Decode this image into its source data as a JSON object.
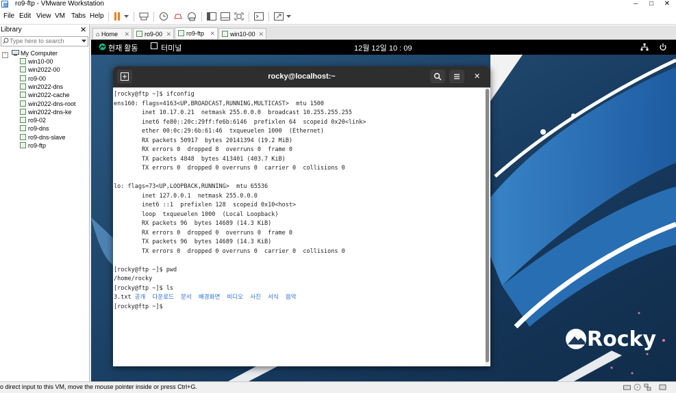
{
  "window": {
    "title": "ro9-ftp - VMware Workstation",
    "controls": [
      "–",
      "□",
      "✕"
    ]
  },
  "menu": [
    "File",
    "Edit",
    "View",
    "VM",
    "Tabs",
    "Help"
  ],
  "library": {
    "title": "Library",
    "search_placeholder": "Type here to search",
    "root": "My Computer",
    "vms": [
      "win10-00",
      "win2022-00",
      "ro9-00",
      "win2022-dns",
      "win2022-cache",
      "win2022-dns-root",
      "win2022-dns-ke",
      "ro9-02",
      "ro9-dns",
      "ro9-dns-slave",
      "ro9-ftp"
    ]
  },
  "tabs": [
    {
      "label": "Home"
    },
    {
      "label": "ro9-00"
    },
    {
      "label": "ro9-ftp"
    },
    {
      "label": "win10-00"
    }
  ],
  "gnome": {
    "activities": "현재 활동",
    "app": "터미널",
    "clock": "12월 12일  10 : 09"
  },
  "terminal": {
    "title": "rocky@localhost:~",
    "lines": [
      "[rocky@ftp ~]$ ifconfig",
      "ens160: flags=4163<UP,BROADCAST,RUNNING,MULTICAST>  mtu 1500",
      "        inet 10.17.0.21  netmask 255.0.0.0  broadcast 10.255.255.255",
      "        inet6 fe80::20c:29ff:fe6b:6146  prefixlen 64  scopeid 0x20<link>",
      "        ether 00:0c:29:6b:61:46  txqueuelen 1000  (Ethernet)",
      "        RX packets 50917  bytes 20141394 (19.2 MiB)",
      "        RX errors 0  dropped 8  overruns 0  frame 0",
      "        TX packets 4848  bytes 413401 (403.7 KiB)",
      "        TX errors 0  dropped 0 overruns 0  carrier 0  collisions 0",
      "",
      "lo: flags=73<UP,LOOPBACK,RUNNING>  mtu 65536",
      "        inet 127.0.0.1  netmask 255.0.0.0",
      "        inet6 ::1  prefixlen 128  scopeid 0x10<host>",
      "        loop  txqueuelen 1000  (Local Loopback)",
      "        RX packets 96  bytes 14689 (14.3 KiB)",
      "        RX errors 0  dropped 0  overruns 0  frame 0",
      "        TX packets 96  bytes 14689 (14.3 KiB)",
      "        TX errors 0  dropped 0 overruns 0  carrier 0  collisions 0",
      "",
      "[rocky@ftp ~]$ pwd",
      "/home/rocky",
      "[rocky@ftp ~]$ ls"
    ],
    "ls_file": "3.txt",
    "ls_dirs": "공개  다운로드  문서  배경화면  비디오  사진  서식  음악",
    "prompt": "[rocky@ftp ~]$"
  },
  "wallpaper": {
    "logo": "Rocky"
  },
  "statusbar": {
    "text": "o direct input to this VM, move the mouse pointer inside or press Ctrl+G."
  }
}
